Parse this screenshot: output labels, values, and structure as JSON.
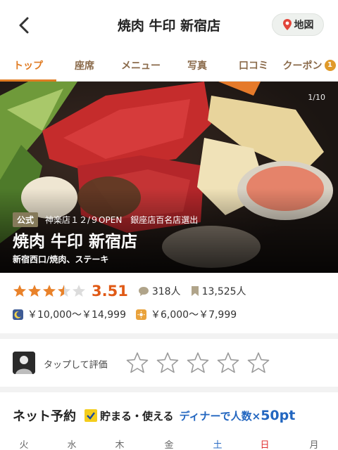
{
  "header": {
    "title": "焼肉 牛印 新宿店",
    "map_label": "地図"
  },
  "tabs": [
    {
      "label": "トップ",
      "active": true
    },
    {
      "label": "座席"
    },
    {
      "label": "メニュー"
    },
    {
      "label": "写真"
    },
    {
      "label": "口コミ"
    },
    {
      "label": "クーポン",
      "badge": "1"
    }
  ],
  "hero": {
    "counter": "1/10",
    "official": "公式",
    "award": "神楽店１２/９OPEN　銀座店百名店選出",
    "name": "焼肉 牛印 新宿店",
    "area": "新宿西口/焼肉、ステーキ"
  },
  "rating": {
    "score": "3.51",
    "stars_filled": 3.5,
    "reviews": "318人",
    "saves": "13,525人"
  },
  "budget": {
    "dinner": "￥10,000～￥14,999",
    "lunch": "￥6,000～￥7,999"
  },
  "review_prompt": {
    "label": "タップして評価"
  },
  "reserve": {
    "heading": "ネット予約",
    "promo1": "貯まる・使える",
    "promo2_text": "ディナーで人数×",
    "promo2_pts": "50pt"
  },
  "days": [
    "火",
    "水",
    "木",
    "金",
    "土",
    "日",
    "月"
  ],
  "colors": {
    "accent": "#e07b22",
    "score": "#e05a16",
    "link": "#2266c0"
  }
}
